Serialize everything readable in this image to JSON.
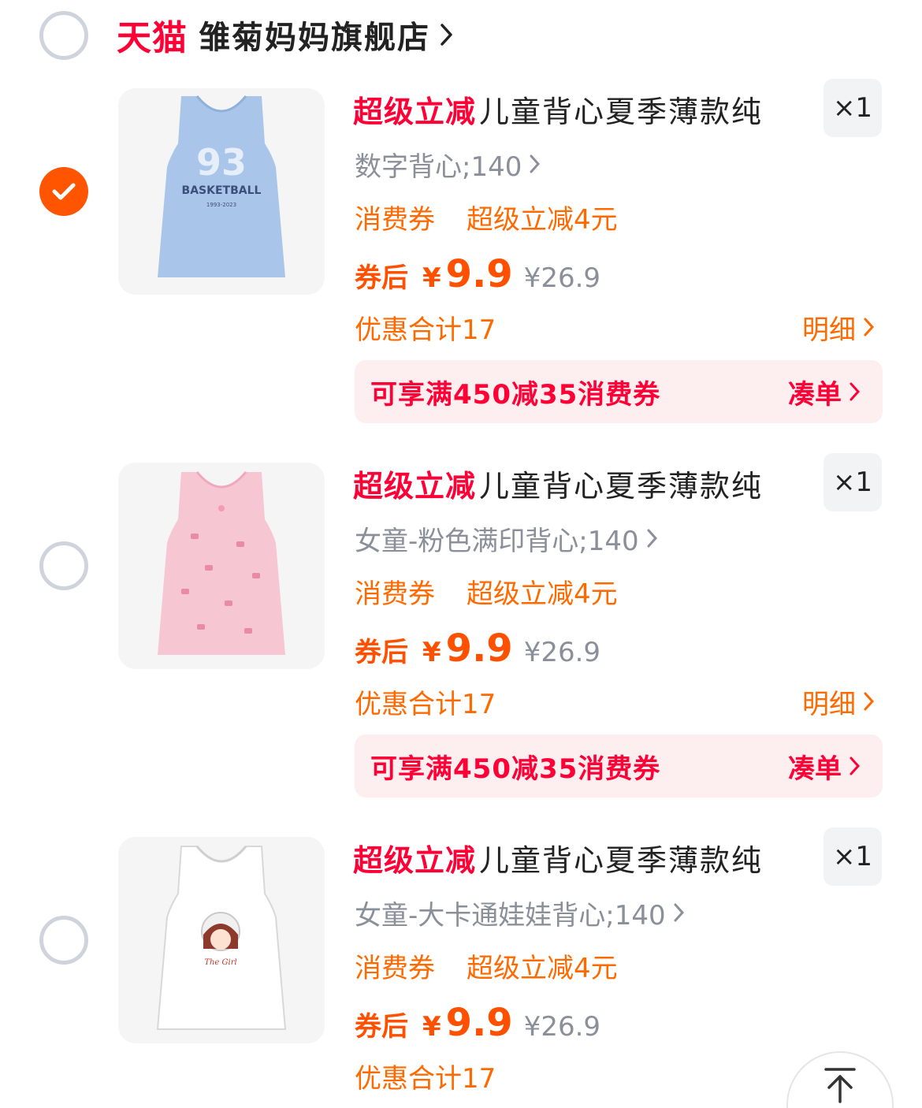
{
  "shop": {
    "platform": "天猫",
    "name": "雏菊妈妈旗舰店"
  },
  "items": [
    {
      "selected": true,
      "badge": "超级立减",
      "title": "儿童背心夏季薄款纯",
      "quantity": "×1",
      "spec": "数字背心;140",
      "promo_tag": "消费券",
      "promo_detail": "超级立减4元",
      "price_label": "券后",
      "currency": "¥",
      "price": "9.9",
      "original_price": "¥26.9",
      "discount_total": "优惠合计17",
      "detail_label": "明细",
      "coupon_text": "可享满450减35消费券",
      "coupon_action": "凑单",
      "image_icon": "blue-basketball-tank-top"
    },
    {
      "selected": false,
      "badge": "超级立减",
      "title": "儿童背心夏季薄款纯",
      "quantity": "×1",
      "spec": "女童-粉色满印背心;140",
      "promo_tag": "消费券",
      "promo_detail": "超级立减4元",
      "price_label": "券后",
      "currency": "¥",
      "price": "9.9",
      "original_price": "¥26.9",
      "discount_total": "优惠合计17",
      "detail_label": "明细",
      "coupon_text": "可享满450减35消费券",
      "coupon_action": "凑单",
      "image_icon": "pink-print-tank-top"
    },
    {
      "selected": false,
      "badge": "超级立减",
      "title": "儿童背心夏季薄款纯",
      "quantity": "×1",
      "spec": "女童-大卡通娃娃背心;140",
      "promo_tag": "消费券",
      "promo_detail": "超级立减4元",
      "price_label": "券后",
      "currency": "¥",
      "price": "9.9",
      "original_price": "¥26.9",
      "discount_total": "优惠合计17",
      "image_icon": "white-cartoon-girl-tank-top"
    }
  ],
  "colors": {
    "accent_orange": "#ff5500",
    "promo_orange": "#ff6a00",
    "tmall_red": "#ff0036",
    "gray_text": "#8a8f99"
  },
  "floating": {
    "back_to_top_icon": "arrow-up-to-top-icon"
  }
}
